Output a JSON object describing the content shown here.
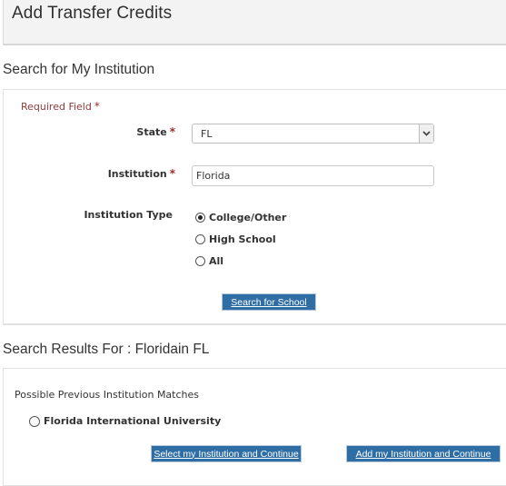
{
  "header": {
    "title": "Add Transfer Credits"
  },
  "search_section": {
    "title": "Search for My Institution",
    "required_note": "Required Field",
    "required_marker": "*",
    "state": {
      "label": "State",
      "value": "FL"
    },
    "institution": {
      "label": "Institution",
      "value": "Florida",
      "placeholder": ""
    },
    "institution_type": {
      "label": "Institution Type",
      "options": [
        {
          "label": "College/Other",
          "checked": true
        },
        {
          "label": "High School",
          "checked": false
        },
        {
          "label": "All",
          "checked": false
        }
      ]
    },
    "search_button": "Search for School"
  },
  "results_section": {
    "title": "Search Results For : Floridain FL",
    "matches_label": "Possible Previous Institution Matches",
    "matches": [
      {
        "name": "Florida International University",
        "checked": false
      }
    ],
    "select_button": "Select my Institution and Continue",
    "add_button": "Add my Institution and Continue"
  },
  "colors": {
    "button_bg": "#2f6ea5",
    "required": "#9b2c2c",
    "header_bg": "#f3f3f3"
  }
}
